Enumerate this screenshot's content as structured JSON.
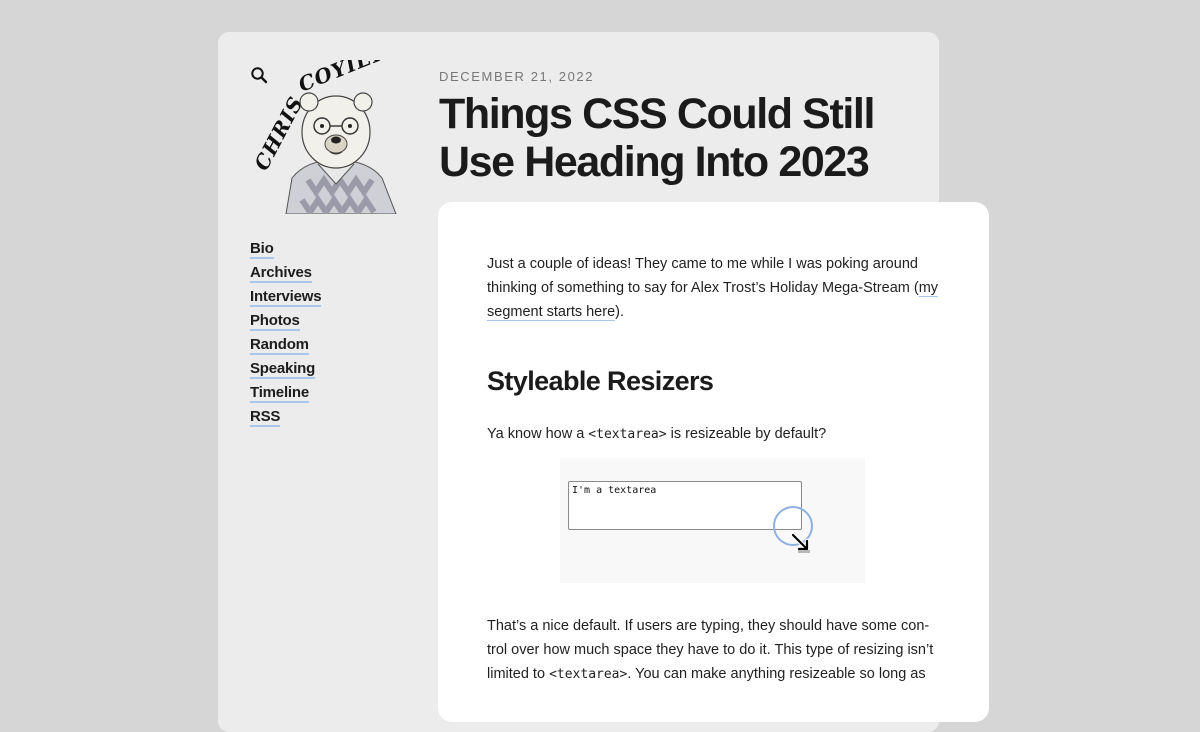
{
  "site": {
    "logo_text": "CHRIS COYIER",
    "search_icon": "search-icon"
  },
  "nav": {
    "items": [
      {
        "label": "Bio"
      },
      {
        "label": "Archives"
      },
      {
        "label": "Interviews"
      },
      {
        "label": "Photos"
      },
      {
        "label": "Random"
      },
      {
        "label": "Speaking"
      },
      {
        "label": "Timeline"
      },
      {
        "label": "RSS"
      }
    ]
  },
  "post": {
    "date": "DECEMBER 21, 2022",
    "title": "Things CSS Could Still Use Heading Into 2023",
    "intro_before": "Just a couple of ideas! They came to me while I was poking around thinking of something to say for Alex Trost’s Holiday Mega-Stream (",
    "intro_link": "my segment starts here",
    "intro_after": ").",
    "section_heading": "Styleable Resizers",
    "p2_before": "Ya know how a ",
    "p2_code": "<textarea>",
    "p2_after": " is resizeable by default?",
    "demo_textarea_text": "I'm a textarea",
    "p3_line1": "That’s a nice default. If users are typing, they should have some con-",
    "p3_line2": "trol over how much space they have to do it. This type of resizing isn’t",
    "p3_before": "limited to ",
    "p3_code": "<textarea>",
    "p3_after": ". You can make anything resizeable so long as"
  },
  "colors": {
    "background": "#d6d6d6",
    "page_card": "#ececec",
    "content_card": "#ffffff",
    "link_underline": "#a8c7ea",
    "resize_highlight": "#8fb0e0"
  }
}
